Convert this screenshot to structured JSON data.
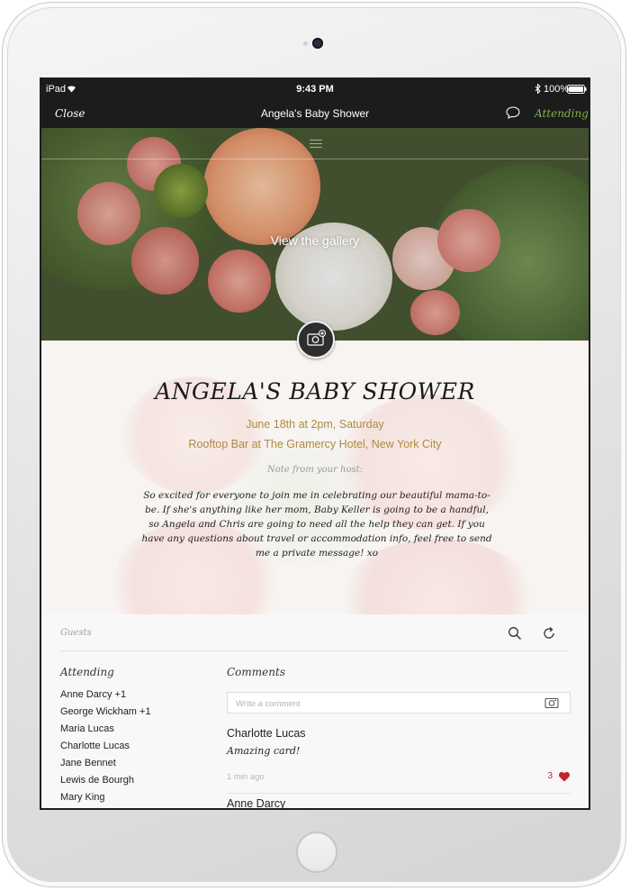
{
  "status": {
    "carrier": "iPad",
    "time": "9:43 PM",
    "battery": "100%"
  },
  "nav": {
    "close": "Close",
    "title": "Angela's Baby Shower",
    "rsvp": "Attending"
  },
  "hero": {
    "gallery_label": "View the gallery"
  },
  "event": {
    "title": "ANGELA'S BABY SHOWER",
    "date": "June 18th at 2pm,  Saturday",
    "venue": "Rooftop Bar at The Gramercy Hotel, New York City",
    "host_label": "Note from your host:",
    "host_note": "So excited for everyone to join me in celebrating our beautiful mama-to-be. If she's anything like her mom, Baby Keller is going to be a handful, so Angela and Chris are going to need all the help they can get. If you have any questions about travel or accommodation info, feel free to send me a private message! xo"
  },
  "guests": {
    "label": "Guests",
    "attending_heading": "Attending",
    "attending": [
      "Anne Darcy +1",
      "George Wickham +1",
      "Maria Lucas",
      "Charlotte Lucas",
      "Jane Bennet",
      "Lewis de Bourgh",
      "Mary King"
    ]
  },
  "comments": {
    "heading": "Comments",
    "placeholder": "Write a comment",
    "items": [
      {
        "author": "Charlotte Lucas",
        "text": "Amazing card!",
        "time": "1 min ago",
        "likes": "3"
      },
      {
        "author": "Anne Darcy",
        "text": "",
        "time": "",
        "likes": ""
      }
    ]
  },
  "colors": {
    "accent_gold": "#b08a3e",
    "attending_green": "#7bb34a",
    "like_red": "#c0262b",
    "bar_dark": "#1c1c1c"
  },
  "icons": [
    "wifi-icon",
    "bluetooth-icon",
    "battery-icon",
    "chat-bubble-icon",
    "camera-add-icon",
    "search-icon",
    "refresh-icon",
    "camera-icon",
    "heart-icon"
  ]
}
